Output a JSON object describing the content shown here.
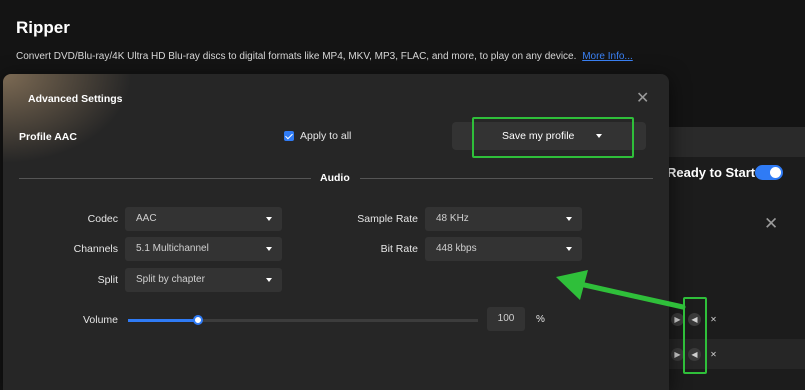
{
  "app": {
    "title": "Ripper",
    "description": "Convert DVD/Blu-ray/4K Ultra HD Blu-ray discs to digital formats like MP4, MKV, MP3, FLAC, and more, to play on any device.",
    "more_link": "More Info..."
  },
  "background": {
    "ready_label": "Ready to Start",
    "toggle_on": true,
    "close_glyph": "✕",
    "row_controls": [
      {
        "play_icon": "play-icon",
        "edit_icon": "audio-settings-icon",
        "close_icon": "close-icon"
      },
      {
        "play_icon": "play-icon",
        "edit_icon": "audio-settings-icon",
        "close_icon": "close-icon"
      }
    ]
  },
  "dialog": {
    "title": "Advanced Settings",
    "close_glyph": "✕",
    "profile_label": "Profile AAC",
    "apply_to_all": {
      "label": "Apply to all",
      "checked": true
    },
    "save_profile_label": "Save my profile",
    "section_title": "Audio",
    "fields": {
      "codec": {
        "label": "Codec",
        "value": "AAC"
      },
      "channels": {
        "label": "Channels",
        "value": "5.1 Multichannel"
      },
      "split": {
        "label": "Split",
        "value": "Split by chapter"
      },
      "sample_rate": {
        "label": "Sample Rate",
        "value": "48 KHz"
      },
      "bit_rate": {
        "label": "Bit Rate",
        "value": "448 kbps"
      }
    },
    "volume": {
      "label": "Volume",
      "value": "100",
      "unit": "%",
      "slider_fraction": 0.2
    }
  },
  "colors": {
    "accent": "#2f7bf5",
    "highlight": "#2fbf3a",
    "link": "#3b82f6"
  }
}
